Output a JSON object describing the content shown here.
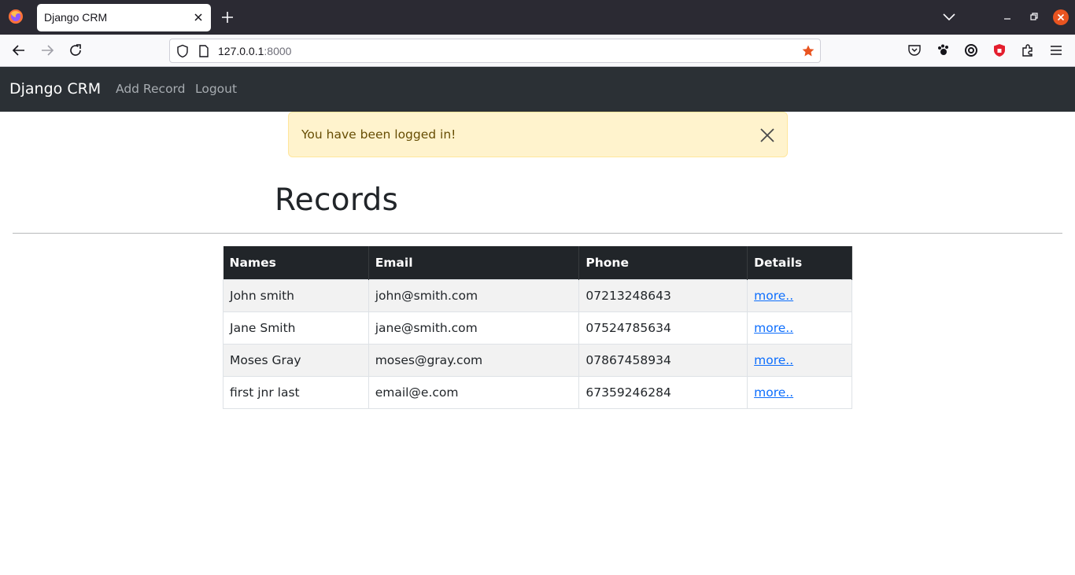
{
  "browser": {
    "tab_title": "Django CRM",
    "url_host": "127.0.0.1",
    "url_port": ":8000"
  },
  "navbar": {
    "brand": "Django CRM",
    "links": [
      "Add Record",
      "Logout"
    ]
  },
  "alert": {
    "message": "You have been logged in!"
  },
  "page": {
    "title": "Records"
  },
  "table": {
    "headers": [
      "Names",
      "Email",
      "Phone",
      "Details"
    ],
    "rows": [
      {
        "name": "John smith",
        "email": "john@smith.com",
        "phone": "07213248643",
        "details": "more.."
      },
      {
        "name": "Jane Smith",
        "email": "jane@smith.com",
        "phone": "07524785634",
        "details": "more.."
      },
      {
        "name": "Moses Gray",
        "email": "moses@gray.com",
        "phone": "07867458934",
        "details": "more.."
      },
      {
        "name": "first jnr last",
        "email": "email@e.com",
        "phone": "67359246284",
        "details": "more.."
      }
    ]
  },
  "colors": {
    "navbar_bg": "#2b3035",
    "alert_bg": "#fff3cd",
    "table_header_bg": "#212529",
    "link": "#0d6efd",
    "accent_star": "#e95420"
  }
}
